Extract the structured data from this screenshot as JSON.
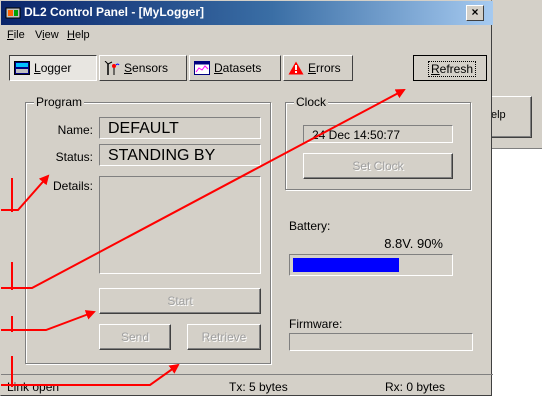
{
  "background_window": {
    "button_fragment": "elp"
  },
  "window": {
    "title": "DL2 Control Panel - [MyLogger]",
    "close_symbol": "×"
  },
  "menu": [
    {
      "label": "File",
      "mnemonic_index": 0
    },
    {
      "label": "View",
      "mnemonic_index": 1
    },
    {
      "label": "Help",
      "mnemonic_index": 0
    }
  ],
  "toolbar": {
    "logger": "Logger",
    "sensors": "Sensors",
    "datasets": "Datasets",
    "errors": "Errors",
    "refresh": "Refresh",
    "active_tab": "logger"
  },
  "program": {
    "group_title": "Program",
    "name_label": "Name:",
    "name_value": "DEFAULT",
    "status_label": "Status:",
    "status_value": "STANDING BY",
    "details_label": "Details:",
    "details_value": "",
    "start_button": "Start",
    "send_button": "Send",
    "retrieve_button": "Retrieve"
  },
  "clock": {
    "group_title": "Clock",
    "value": "24 Dec 14:50:77",
    "set_clock_button": "Set Clock"
  },
  "battery": {
    "label": "Battery:",
    "reading": "8.8V. 90%",
    "level_fraction": 0.68,
    "bar_color": "#0000ff"
  },
  "firmware": {
    "label": "Firmware:",
    "value": ""
  },
  "status_bar": {
    "link": "Link open",
    "tx": "Tx: 5 bytes",
    "rx": "Rx: 0 bytes"
  },
  "annotation_color": "#ff0000"
}
